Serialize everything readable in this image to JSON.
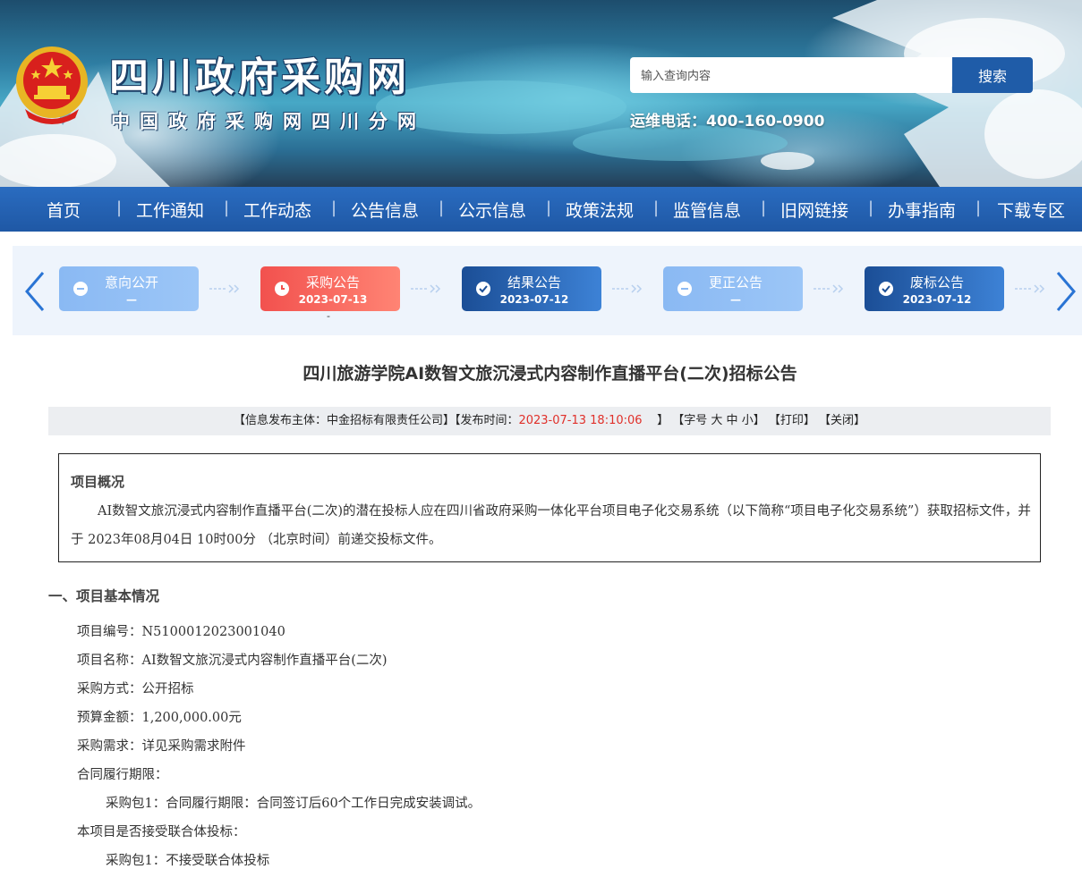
{
  "header": {
    "site_title": "四川政府采购网",
    "site_subtitle": "中国政府采购网四川分网",
    "search_placeholder": "输入查询内容",
    "search_button": "搜索",
    "hotline": "运维电话：400-160-0900"
  },
  "nav": [
    "首页",
    "工作通知",
    "工作动态",
    "公告信息",
    "公示信息",
    "政策法规",
    "监管信息",
    "旧网链接",
    "办事指南",
    "下载专区"
  ],
  "timeline": {
    "steps": [
      {
        "label": "意向公开",
        "date": "—",
        "status": "inactive"
      },
      {
        "label": "采购公告",
        "date": "2023-07-13",
        "status": "current"
      },
      {
        "label": "结果公告",
        "date": "2023-07-12",
        "status": "done"
      },
      {
        "label": "更正公告",
        "date": "—",
        "status": "inactive"
      },
      {
        "label": "废标公告",
        "date": "2023-07-12",
        "status": "done"
      }
    ],
    "note": "-"
  },
  "document": {
    "title": "四川旅游学院AI数智文旅沉浸式内容制作直播平台(二次)招标公告",
    "meta": {
      "publisher_prefix": "【信息发布主体：中金招标有限责任公司】【发布时间：",
      "publish_time": "2023-07-13 18:10:06",
      "publish_suffix": "】",
      "font_size_label": "【字号",
      "size_large": "大",
      "size_medium": "中",
      "size_small": "小",
      "font_size_end": "】",
      "print": "【打印】",
      "close": "【关闭】"
    },
    "overview": {
      "heading": "项目概况",
      "text": "AI数智文旅沉浸式内容制作直播平台(二次)的潜在投标人应在四川省政府采购一体化平台项目电子化交易系统（以下简称“项目电子化交易系统”）获取招标文件，并于 2023年08月04日 10时00分 （北京时间）前递交投标文件。"
    },
    "section1": {
      "heading": "一、项目基本情况",
      "lines": [
        "项目编号：N5100012023001040",
        "项目名称：AI数智文旅沉浸式内容制作直播平台(二次)",
        "采购方式：公开招标",
        "预算金额：1,200,000.00元",
        "采购需求：详见采购需求附件",
        "合同履行期限：",
        "采购包1：合同履行期限：合同签订后60个工作日完成安装调试。",
        "本项目是否接受联合体投标：",
        "采购包1：不接受联合体投标"
      ]
    }
  },
  "colors": {
    "nav_bg": "#2563b4",
    "accent_red": "#e0302a",
    "step_light": "#8ab9f3",
    "step_current": "#f2514e",
    "step_done": "#1b4e96"
  }
}
